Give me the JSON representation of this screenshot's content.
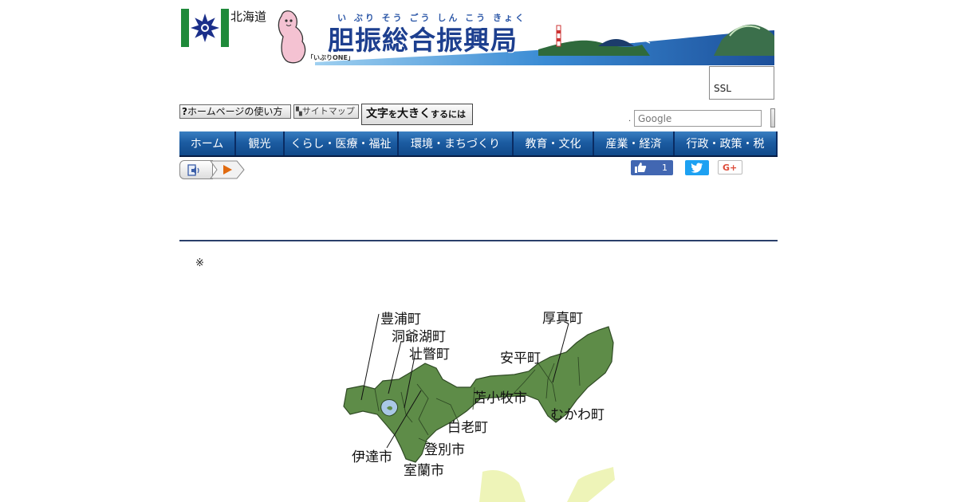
{
  "header": {
    "pref_name": "北海道",
    "mascot_label": "「いぶりONE」",
    "ruby": "い ぶり そう ごう しん こう きょく",
    "title": "胆振総合振興局",
    "ssl_label": "SSL"
  },
  "utility": {
    "help_label": "ホームページの使い方",
    "sitemap_label": "サイトマップ",
    "bigtext_main": "文字",
    "bigtext_wo": "を",
    "bigtext_ookiku": "大きく",
    "bigtext_suffix": "するには",
    "search_placeholder": "Google"
  },
  "nav": {
    "items": [
      {
        "label": "ホーム"
      },
      {
        "label": "観光"
      },
      {
        "label": "くらし・医療・福祉"
      },
      {
        "label": "環境・まちづくり"
      },
      {
        "label": "教育・文化"
      },
      {
        "label": "産業・経済"
      },
      {
        "label": "行政・政策・税"
      }
    ]
  },
  "social": {
    "like_count": "1",
    "gplus_label": "G+"
  },
  "content": {
    "note": "※"
  },
  "map": {
    "land_color": "#5e8c48",
    "water_color": "#a9c8e6",
    "labels": {
      "toyoura": "豊浦町",
      "toyako": "洞爺湖町",
      "sobetsu": "壮瞥町",
      "atsuma": "厚真町",
      "abira": "安平町",
      "tomakomai": "苫小牧市",
      "shiraoi": "白老町",
      "mukawa": "むかわ町",
      "noboribetsu": "登別市",
      "date": "伊達市",
      "muroran": "室蘭市"
    }
  },
  "colors": {
    "nav_bg": "#0a2c63",
    "nav_grad_top": "#3a7fc2",
    "rule": "#2a3f6b",
    "like_bg": "#4267b2",
    "twitter_bg": "#1da1f2"
  }
}
